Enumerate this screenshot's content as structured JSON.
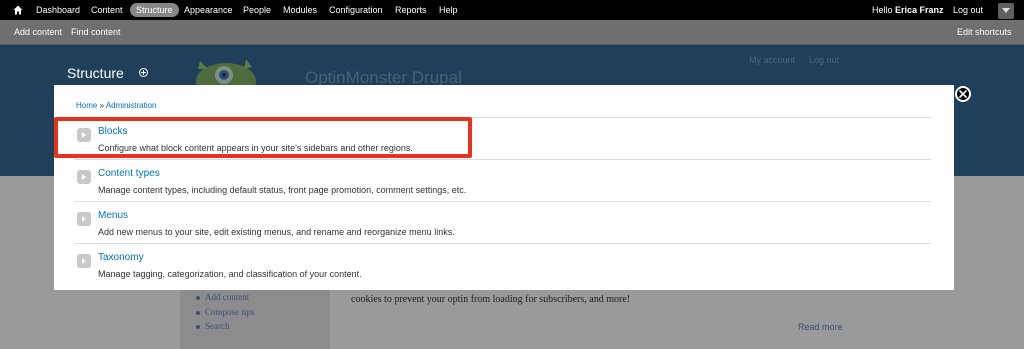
{
  "toolbar": {
    "items": [
      "Dashboard",
      "Content",
      "Structure",
      "Appearance",
      "People",
      "Modules",
      "Configuration",
      "Reports",
      "Help"
    ],
    "hello_prefix": "Hello",
    "user_name": "Erica Franz",
    "logout": "Log out"
  },
  "shortcuts": {
    "items": [
      "Add content",
      "Find content"
    ],
    "edit": "Edit shortcuts"
  },
  "background": {
    "page_title": "Structure",
    "site_name": "OptinMonster Drupal",
    "user_links": [
      "My account",
      "Log out"
    ],
    "sidebar_links": [
      "Add content",
      "Compose tips",
      "Search"
    ],
    "body_text": "cookies to prevent your optin from loading for subscribers, and more!",
    "read_more": "Read more"
  },
  "overlay": {
    "breadcrumb": [
      "Home",
      "»",
      "Administration"
    ],
    "items": [
      {
        "title": "Blocks",
        "desc": "Configure what block content appears in your site's sidebars and other regions."
      },
      {
        "title": "Content types",
        "desc": "Manage content types, including default status, front page promotion, comment settings, etc."
      },
      {
        "title": "Menus",
        "desc": "Add new menus to your site, edit existing menus, and rename and reorganize menu links."
      },
      {
        "title": "Taxonomy",
        "desc": "Manage tagging, categorization, and classification of your content."
      }
    ]
  },
  "colors": {
    "toolbar_bg": "#000000",
    "link": "#0074bd",
    "highlight": "#e8321e"
  }
}
